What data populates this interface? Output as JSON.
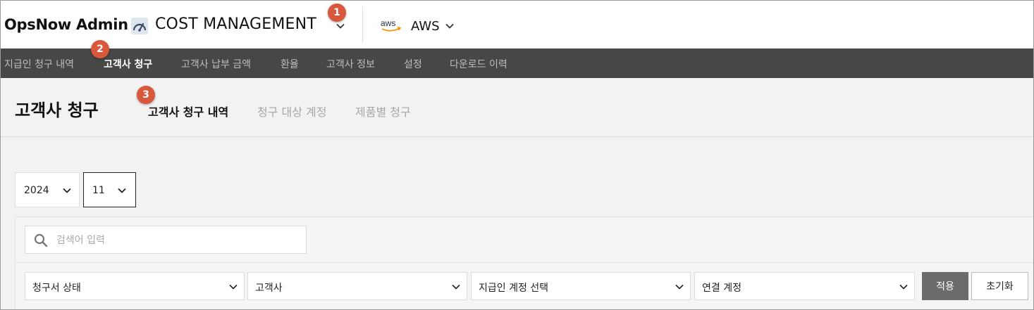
{
  "header": {
    "brand": "OpsNow Admin",
    "module_title": "COST MANAGEMENT",
    "cloud_label": "AWS",
    "aws_logo_text": "aws"
  },
  "badges": [
    "1",
    "2",
    "3"
  ],
  "nav": {
    "items": [
      {
        "label": "지급인 청구 내역",
        "active": false
      },
      {
        "label": "고객사 청구",
        "active": true
      },
      {
        "label": "고객사 납부 금액",
        "active": false
      },
      {
        "label": "환율",
        "active": false
      },
      {
        "label": "고객사 정보",
        "active": false
      },
      {
        "label": "설정",
        "active": false
      },
      {
        "label": "다운로드 이력",
        "active": false
      }
    ]
  },
  "page": {
    "title": "고객사 청구",
    "tabs": [
      {
        "label": "고객사 청구 내역",
        "active": true
      },
      {
        "label": "청구 대상 계정",
        "active": false
      },
      {
        "label": "제품별 청구",
        "active": false
      }
    ]
  },
  "period": {
    "year": "2024",
    "month": "11"
  },
  "search": {
    "placeholder": "검색어 입력",
    "value": ""
  },
  "filters": [
    {
      "label": "청구서 상태"
    },
    {
      "label": "고객사"
    },
    {
      "label": "지급인 계정 선택"
    },
    {
      "label": "연결 계정"
    }
  ],
  "buttons": {
    "apply": "적용",
    "reset": "초기화"
  },
  "colors": {
    "badge": "#d9583b",
    "nav_bg": "#474747",
    "apply_bg": "#6b6b6b",
    "aws_orange": "#f79400"
  }
}
